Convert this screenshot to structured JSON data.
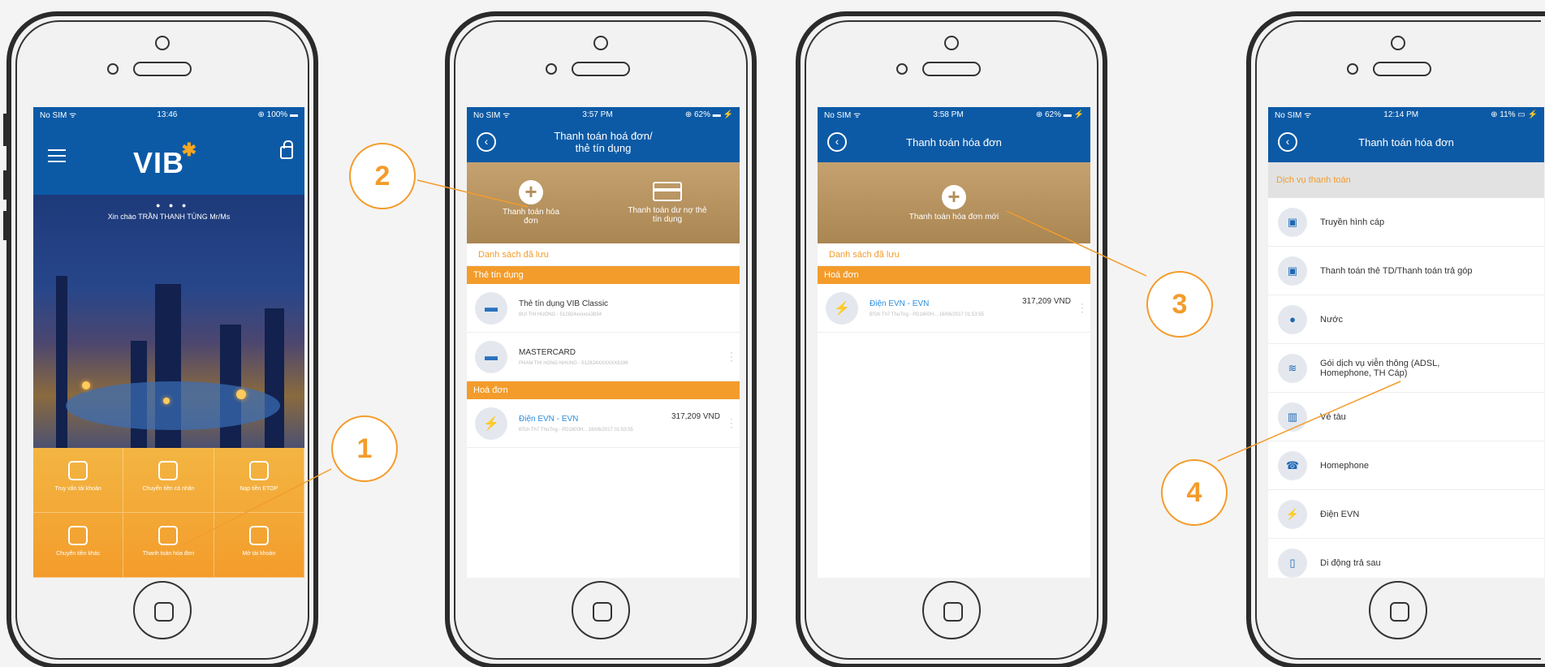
{
  "phone1": {
    "status": {
      "carrier": "No SIM ᯤ",
      "time": "13:46",
      "battery": "⊕ 100% ▬"
    },
    "logo": "VIB",
    "logo_mark": "✱",
    "carousel_dots": "● ● ●",
    "greeting": "Xin chào TRẦN THANH TÙNG Mr/Ms",
    "menu": [
      {
        "label": "Truy vấn tài khoản"
      },
      {
        "label": "Chuyển tiền cá nhân"
      },
      {
        "label": "Nạp tiền ETOP"
      },
      {
        "label": "Chuyển tiền khác"
      },
      {
        "label": "Thanh toán hóa đơn"
      },
      {
        "label": "Mở tài khoản"
      }
    ]
  },
  "phone2": {
    "status": {
      "carrier": "No SIM ᯤ",
      "time": "3:57 PM",
      "battery": "⊕ 62% ▬ ⚡"
    },
    "title_line1": "Thanh toán hoá đơn/",
    "title_line2": "thẻ tín dụng",
    "action1": "Thanh toán hóa đơn",
    "action2": "Thanh toán dư nợ thẻ tín dụng",
    "saved_list": "Danh sách đã lưu",
    "section_credit": "Thẻ tín dụng",
    "cards": [
      {
        "title": "Thẻ tín dụng VIB Classic",
        "sub": "BUI THI HUONG - 512824xxxxxx3834"
      },
      {
        "title": "MASTERCARD",
        "sub": "PHAM THI HONG NHUNG - 512824XXXXXX8196"
      }
    ],
    "section_bill": "Hoá đơn",
    "bill": {
      "title": "Điện EVN - EVN",
      "amount": "317,209 VND",
      "sub": "BTch Th7 Thư7ng - PD1600H... 16/06/2017 01:53:55"
    }
  },
  "phone3": {
    "status": {
      "carrier": "No SIM ᯤ",
      "time": "3:58 PM",
      "battery": "⊕ 62% ▬ ⚡"
    },
    "title": "Thanh toán hóa đơn",
    "action": "Thanh toán hóa đơn mới",
    "saved_list": "Danh sách đã lưu",
    "section_bill": "Hoá đơn",
    "bill": {
      "title": "Điện EVN - EVN",
      "amount": "317,209 VND",
      "sub": "BTch Th7 Thư7ng - PD1600H... 16/06/2017 01:53:55"
    }
  },
  "phone4": {
    "status": {
      "carrier": "No SIM ᯤ",
      "time": "12:14 PM",
      "battery": "⊕ 11% ▭ ⚡"
    },
    "title": "Thanh toán hóa đơn",
    "services_header": "Dịch vụ thanh toán",
    "services": [
      {
        "label": "Truyền hình cáp",
        "icon": "tv-icon"
      },
      {
        "label": "Thanh toán thẻ TD/Thanh toán trả góp",
        "icon": "tv-icon"
      },
      {
        "label": "Nước",
        "icon": "water-drop-icon"
      },
      {
        "label": "Gói dịch vụ viễn thông (ADSL, Homephone, TH Cáp)",
        "icon": "wifi-icon"
      },
      {
        "label": "Vé tàu",
        "icon": "train-icon"
      },
      {
        "label": "Homephone",
        "icon": "telephone-icon"
      },
      {
        "label": "Điện EVN",
        "icon": "lightning-icon"
      },
      {
        "label": "Di động trả sau",
        "icon": "mobile-icon"
      }
    ]
  },
  "callouts": [
    "1",
    "2",
    "3",
    "4"
  ],
  "colors": {
    "brand_blue": "#0c5aa6",
    "accent_orange": "#f39c2b",
    "gold": "#b38f5c"
  }
}
